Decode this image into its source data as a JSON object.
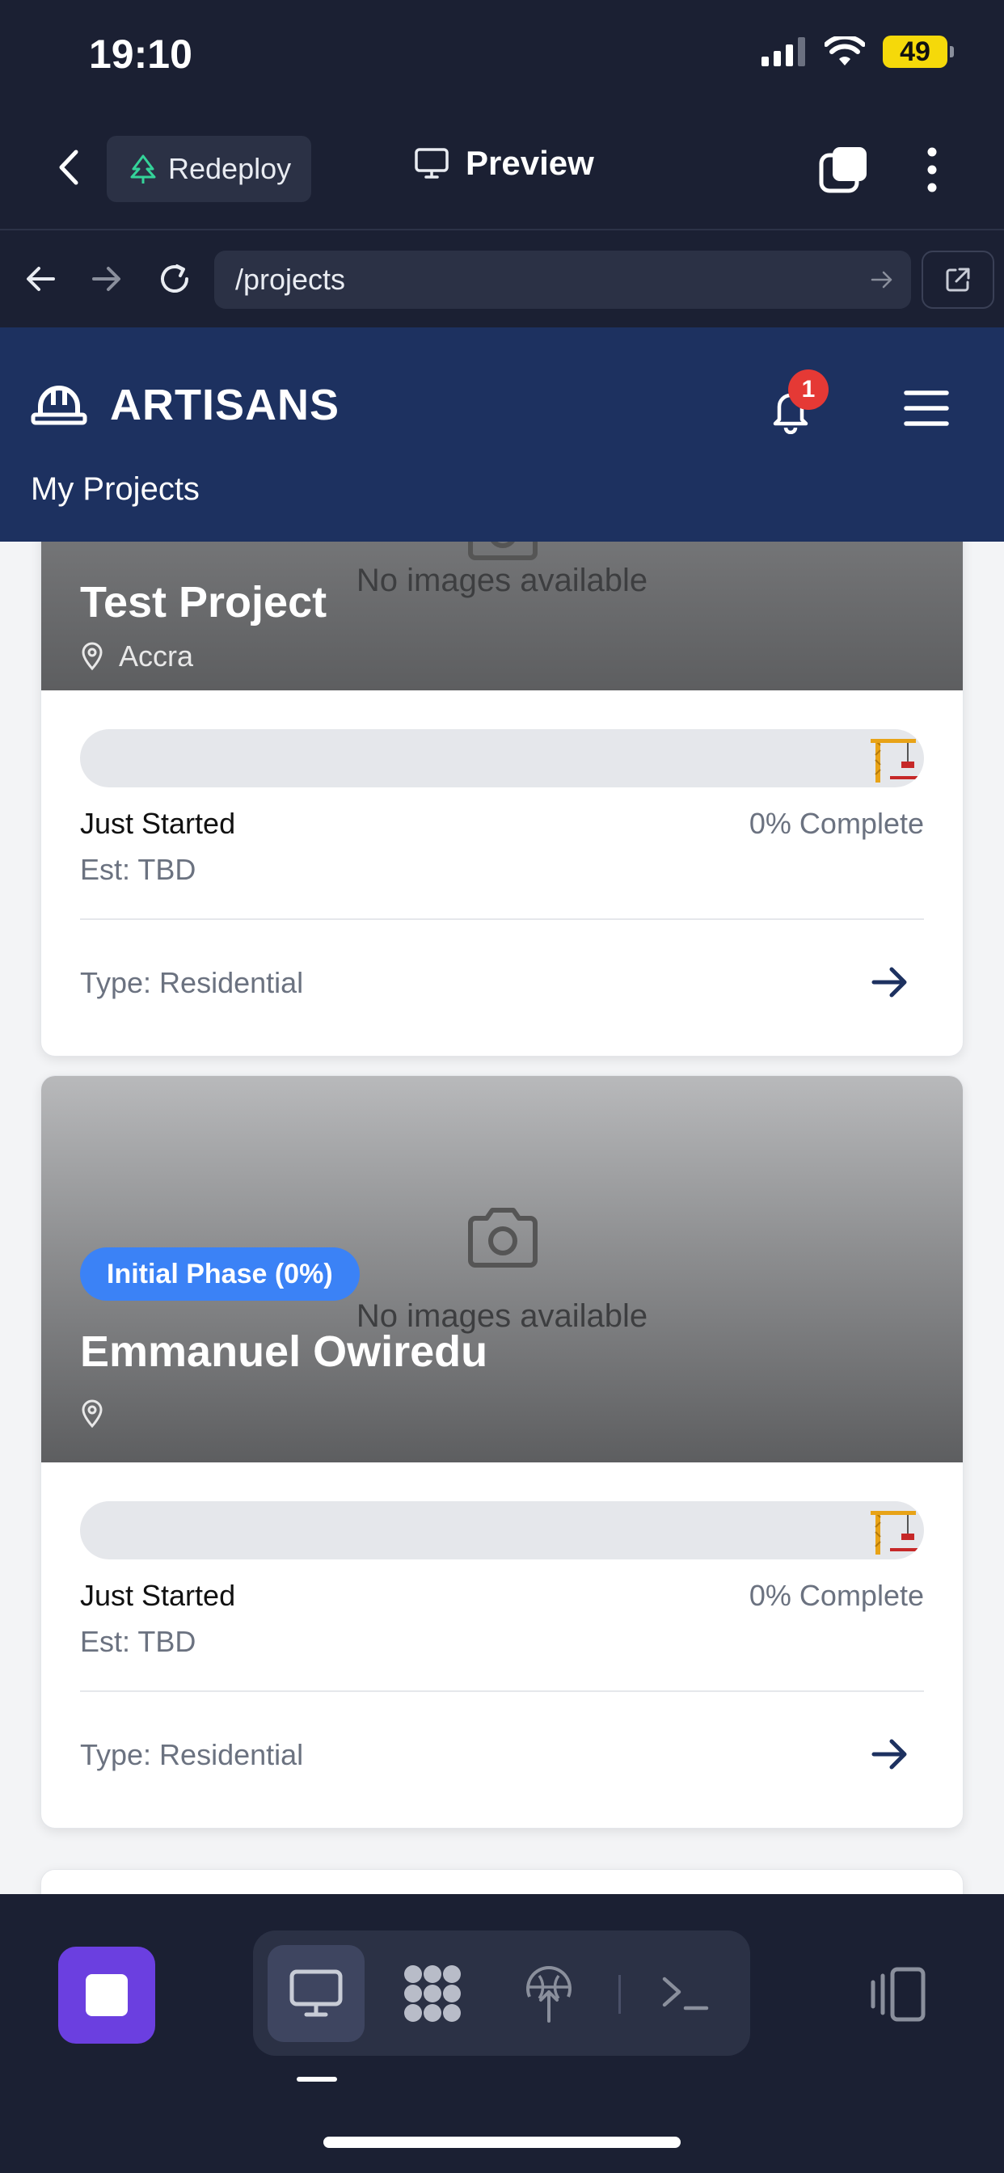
{
  "status_bar": {
    "time": "19:10",
    "battery": "49"
  },
  "builder": {
    "redeploy_label": "Redeploy",
    "preview_label": "Preview"
  },
  "url_bar": {
    "path": "/projects"
  },
  "app": {
    "brand": "ARTISANS",
    "notification_count": "1",
    "page_subtitle": "My Projects"
  },
  "projects": [
    {
      "name": "Test Project",
      "location": "Accra",
      "no_images_text": "No images available",
      "status": "Just Started",
      "complete_text": "0% Complete",
      "progress_fraction": 0,
      "estimate": "Est: TBD",
      "type": "Type: Residential"
    },
    {
      "name": "Emmanuel Owiredu",
      "phase_badge": "Initial Phase (0%)",
      "location": "",
      "no_images_text": "No images available",
      "status": "Just Started",
      "complete_text": "0% Complete",
      "progress_fraction": 0,
      "estimate": "Est: TBD",
      "type": "Type: Residential"
    }
  ],
  "icons": {
    "builder_back": "chevron-left-icon",
    "redeploy": "tree-icon",
    "preview": "monitor-icon",
    "tabs": "tabs-icon",
    "more": "more-vertical-icon",
    "nav_back": "arrow-left-icon",
    "nav_forward": "arrow-right-icon",
    "reload": "reload-icon",
    "url_go": "arrow-right-icon",
    "open_external": "external-link-icon",
    "brand": "hard-hat-icon",
    "bell": "bell-icon",
    "menu": "hamburger-menu-icon",
    "camera": "camera-icon",
    "location": "map-pin-icon",
    "crane": "crane-icon",
    "card_arrow": "arrow-right-icon",
    "stop": "stop-icon",
    "desktop": "monitor-icon",
    "integrations": "nodes-icon",
    "deploy": "globe-upload-icon",
    "terminal": "terminal-icon",
    "split_view": "split-view-icon"
  },
  "colors": {
    "chrome_bg": "#1b2033",
    "app_header": "#1d3160",
    "accent_blue": "#3b82f6",
    "stop_purple": "#6b3fe0",
    "badge_red": "#e53935"
  }
}
